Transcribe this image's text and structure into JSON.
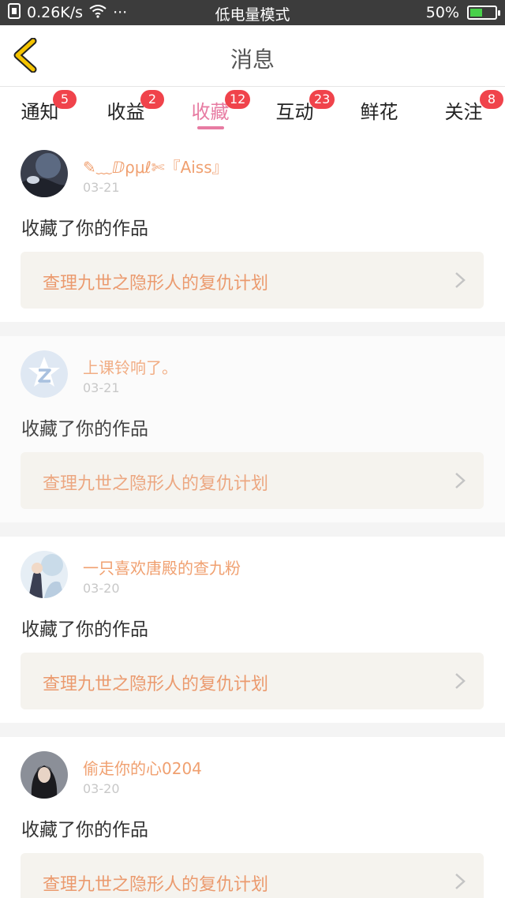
{
  "status_bar": {
    "speed": "0.26K/s",
    "dots": "···",
    "mode": "低电量模式",
    "battery": "50%",
    "battery_level": 0.5
  },
  "header": {
    "title": "消息"
  },
  "tabs": [
    {
      "label": "通知",
      "badge": "5"
    },
    {
      "label": "收益",
      "badge": "2"
    },
    {
      "label": "收藏",
      "badge": "12",
      "active": true
    },
    {
      "label": "互动",
      "badge": "23"
    },
    {
      "label": "鲜花",
      "badge": ""
    },
    {
      "label": "关注",
      "badge": "8"
    }
  ],
  "items": [
    {
      "user": "✎﹏ⅅρμℓ✄『Aiss』",
      "date": "03-21",
      "action": "收藏了你的作品",
      "work": "查理九世之隐形人的复仇计划",
      "avatar": "dark-photo-avatar"
    },
    {
      "user": "上课铃响了。",
      "date": "03-21",
      "action": "收藏了你的作品",
      "work": "查理九世之隐形人的复仇计划",
      "avatar": "default-z-avatar"
    },
    {
      "user": "一只喜欢唐殿的查九粉",
      "date": "03-20",
      "action": "收藏了你的作品",
      "work": "查理九世之隐形人的复仇计划",
      "avatar": "illustration-avatar"
    },
    {
      "user": "偷走你的心0204",
      "date": "03-20",
      "action": "收藏了你的作品",
      "work": "查理九世之隐形人的复仇计划",
      "avatar": "girl-photo-avatar"
    }
  ],
  "colors": {
    "accent": "#e77ba2",
    "badge": "#f0434b",
    "username": "#f0a070",
    "work_title": "#eb9a6e",
    "back_arrow": "#f5c400"
  }
}
